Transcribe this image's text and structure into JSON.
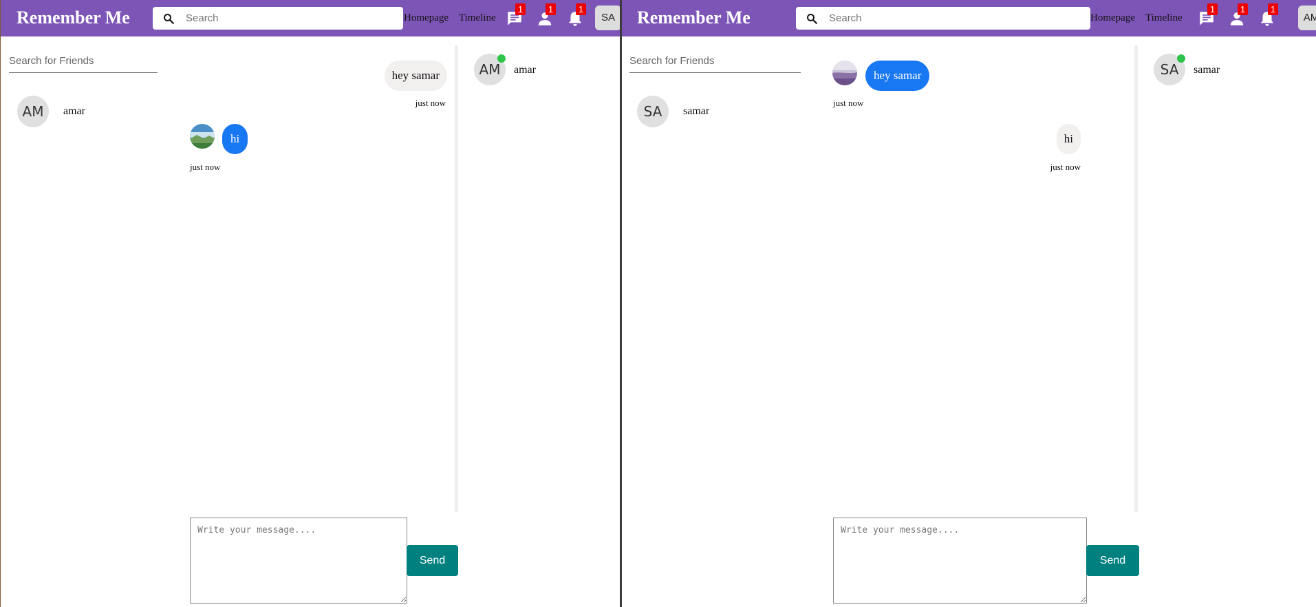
{
  "app": {
    "name": "Remember Me"
  },
  "colors": {
    "brand": "#7d55b7",
    "badge": "#e00000",
    "incoming_bubble": "#1877f2",
    "send_button": "#00807f",
    "online": "#2ec44a"
  },
  "left": {
    "topbar": {
      "search_placeholder": "Search",
      "nav": {
        "homepage": "Homepage",
        "timeline": "Timeline"
      },
      "badges": {
        "messages": "1",
        "friend_requests": "1",
        "notifications": "1"
      },
      "user_initials": "SA"
    },
    "friends": {
      "search_placeholder": "Search for Friends",
      "items": [
        {
          "initials": "AM",
          "name": "amar"
        }
      ]
    },
    "chat": {
      "messages": [
        {
          "text": "hey samar",
          "time": "just now",
          "direction": "outgoing"
        },
        {
          "text": "hi",
          "time": "just now",
          "direction": "incoming",
          "photo": "landscape-photo"
        }
      ],
      "input_placeholder": "Write your message....",
      "send_label": "Send"
    },
    "online": [
      {
        "initials": "AM",
        "name": "amar"
      }
    ]
  },
  "right": {
    "topbar": {
      "search_placeholder": "Search",
      "nav": {
        "homepage": "Homepage",
        "timeline": "Timeline"
      },
      "badges": {
        "messages": "1",
        "friend_requests": "1",
        "notifications": "1"
      },
      "user_initials": "AM"
    },
    "friends": {
      "search_placeholder": "Search for Friends",
      "items": [
        {
          "initials": "SA",
          "name": "samar"
        }
      ]
    },
    "chat": {
      "messages": [
        {
          "text": "hey samar",
          "time": "just now",
          "direction": "incoming",
          "photo": "lavender-photo"
        },
        {
          "text": "hi",
          "time": "just now",
          "direction": "outgoing"
        }
      ],
      "input_placeholder": "Write your message....",
      "send_label": "Send"
    },
    "online": [
      {
        "initials": "SA",
        "name": "samar"
      }
    ]
  }
}
